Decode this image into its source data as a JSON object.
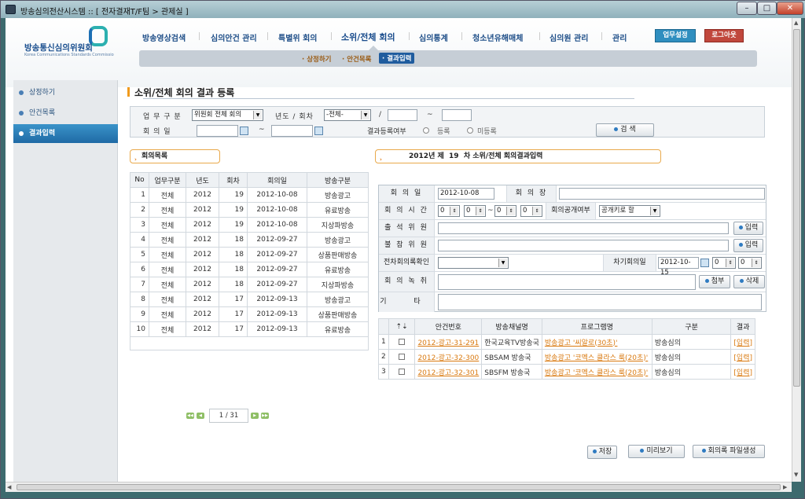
{
  "window": {
    "title": "방송심의전산시스템 :: [ 전자결재T/F팀 > 관제실 ]"
  },
  "logo": {
    "name": "방송통신심의위원회",
    "sub": "Korea Communications Standards Commissio"
  },
  "topnav": [
    "방송영상검색",
    "심의안건 관리",
    "특별위 회의",
    "소위/전체 회의",
    "심의통계",
    "청소년유해매체",
    "심의원 관리",
    "관리"
  ],
  "header_buttons": {
    "settings": "업무설정",
    "logout": "로그아웃"
  },
  "subnav": [
    "상정하기",
    "안건목록",
    "결과입력"
  ],
  "sidebar": [
    {
      "label": "상정하기"
    },
    {
      "label": "안건목록"
    },
    {
      "label": "결과입력"
    }
  ],
  "page_title": "소위/전체 회의 결과 등록",
  "search": {
    "type_label": "업 무 구 분",
    "type_value": "위원회 전체 회의",
    "year_label": "년도 / 회차",
    "year_value": "-전체-",
    "slash": "/",
    "tilde": "~",
    "date_label": "회 의 일",
    "result_label": "결과등록여부",
    "opt_registered": "등록",
    "opt_unregistered": "미등록",
    "search_button": "검 색"
  },
  "list_section": "회의목록",
  "list_headers": [
    "No",
    "업무구분",
    "년도",
    "회차",
    "회의일",
    "방송구분"
  ],
  "list_rows": [
    [
      "1",
      "전체",
      "2012",
      "19",
      "2012-10-08",
      "방송광고"
    ],
    [
      "2",
      "전체",
      "2012",
      "19",
      "2012-10-08",
      "유료방송"
    ],
    [
      "3",
      "전체",
      "2012",
      "19",
      "2012-10-08",
      "지상파방송"
    ],
    [
      "4",
      "전체",
      "2012",
      "18",
      "2012-09-27",
      "방송광고"
    ],
    [
      "5",
      "전체",
      "2012",
      "18",
      "2012-09-27",
      "상품판매방송"
    ],
    [
      "6",
      "전체",
      "2012",
      "18",
      "2012-09-27",
      "유료방송"
    ],
    [
      "7",
      "전체",
      "2012",
      "18",
      "2012-09-27",
      "지상파방송"
    ],
    [
      "8",
      "전체",
      "2012",
      "17",
      "2012-09-13",
      "방송광고"
    ],
    [
      "9",
      "전체",
      "2012",
      "17",
      "2012-09-13",
      "상품판매방송"
    ],
    [
      "10",
      "전체",
      "2012",
      "17",
      "2012-09-13",
      "유료방송"
    ]
  ],
  "pager": {
    "text": "1 / 31"
  },
  "result": {
    "header_year": "2012",
    "header_text": "년 제  19  차 소위/전체 회의결과입력",
    "date_label": "회 의 일",
    "date_value": "2012-10-08",
    "chair_label": "회 의 장",
    "time_label": "회 의 시 간",
    "time_h1": "0",
    "time_m1": "0",
    "time_h2": "0",
    "time_m2": "0",
    "public_label": "회의공개여부",
    "public_value": "공개키로 할",
    "attend_label": "출 석 위 원",
    "absent_label": "불 참 위 원",
    "input_button": "입력",
    "confirm_label": "전차회의록확인",
    "next_label": "차기회의일",
    "next_value": "2012-10-15",
    "next_h": "0",
    "next_m": "0",
    "record_label": "회 의 녹 취",
    "attach_button": "첨부",
    "delete_button": "삭제",
    "etc_label": "기 타"
  },
  "agenda_headers": [
    "안건번호",
    "방송채널명",
    "프로그램명",
    "구분",
    "결과"
  ],
  "agenda_rows": [
    [
      "1",
      "2012-광고-31-291",
      "한국교육TV방송국",
      "방송광고 '씨알로(30초)'",
      "방송심의",
      "[입력]"
    ],
    [
      "2",
      "2012-광고-32-300",
      "SBSAM 방송국",
      "방송광고 '코멕스 클라스 룩(20초)'",
      "방송심의",
      "[입력]"
    ],
    [
      "3",
      "2012-광고-32-301",
      "SBSFM 방송국",
      "방송광고 '코멕스 클라스 룩(20초)'",
      "방송심의",
      "[입력]"
    ]
  ],
  "bottom_buttons": {
    "save": "저장",
    "preview": "미리보기",
    "file": "회의록 파일생성"
  },
  "colors": {
    "accent": "#1f5c9e",
    "link": "#d9790f",
    "section_border": "#e9a94b"
  }
}
